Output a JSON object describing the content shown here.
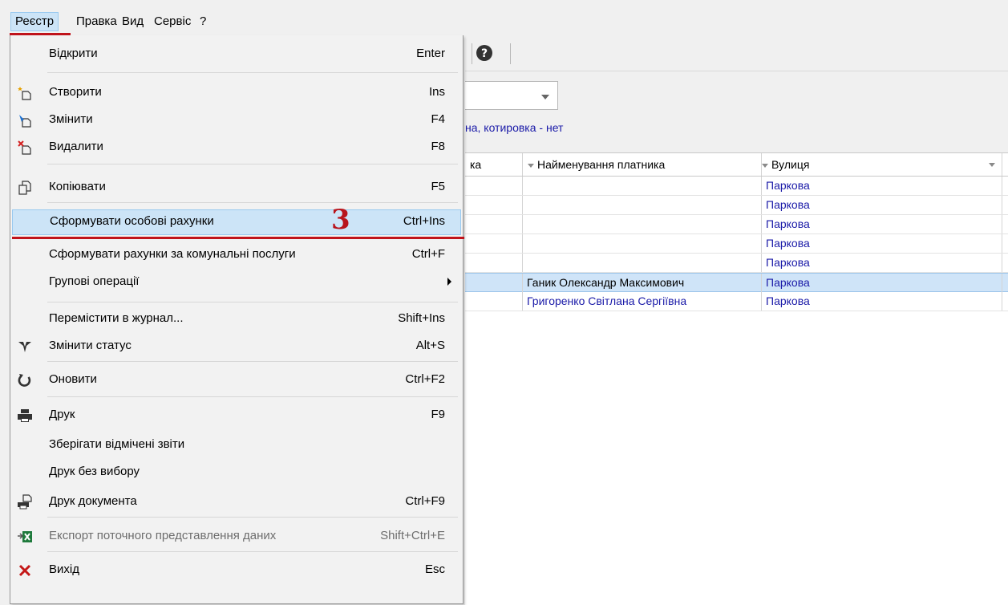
{
  "menubar": {
    "items": [
      "Реєстр",
      "Правка",
      "Вид",
      "Сервіс",
      "?"
    ]
  },
  "filter": {
    "info_text": "на, котировка - нет"
  },
  "grid": {
    "columns": [
      "ка",
      "Найменування платника",
      "Вулиця"
    ],
    "rows": [
      {
        "col1": "",
        "payer": "",
        "street": "Паркова"
      },
      {
        "col1": "",
        "payer": "",
        "street": "Паркова"
      },
      {
        "col1": "",
        "payer": "",
        "street": "Паркова"
      },
      {
        "col1": "",
        "payer": "",
        "street": "Паркова"
      },
      {
        "col1": "",
        "payer": "",
        "street": "Паркова"
      },
      {
        "col1": "",
        "payer": "Ганик Олександр Максимович",
        "street": "Паркова",
        "selected": true
      },
      {
        "col1": "",
        "payer": "Григоренко Світлана Сергіївна",
        "street": "Паркова"
      }
    ]
  },
  "menu": {
    "items": [
      {
        "label": "Відкрити",
        "shortcut": "Enter",
        "icon": "none"
      },
      {
        "label": "Створити",
        "shortcut": "Ins",
        "icon": "create-icon"
      },
      {
        "label": "Змінити",
        "shortcut": "F4",
        "icon": "edit-icon"
      },
      {
        "label": "Видалити",
        "shortcut": "F8",
        "icon": "delete-icon"
      },
      {
        "label": "Копіювати",
        "shortcut": "F5",
        "icon": "copy-icon"
      },
      {
        "label": "Сформувати особові рахунки",
        "shortcut": "Ctrl+Ins",
        "icon": "none",
        "highlighted": true
      },
      {
        "label": "Сформувати рахунки за комунальні послуги",
        "shortcut": "Ctrl+F",
        "icon": "none"
      },
      {
        "label": "Групові операції",
        "shortcut": "",
        "icon": "none",
        "submenu": true
      },
      {
        "label": "Перемістити в журнал...",
        "shortcut": "Shift+Ins",
        "icon": "none"
      },
      {
        "label": "Змінити статус",
        "shortcut": "Alt+S",
        "icon": "status-icon"
      },
      {
        "label": "Оновити",
        "shortcut": "Ctrl+F2",
        "icon": "refresh-icon"
      },
      {
        "label": "Друк",
        "shortcut": "F9",
        "icon": "printer-icon"
      },
      {
        "label": "Зберігати відмічені звіти",
        "shortcut": "",
        "icon": "none"
      },
      {
        "label": "Друк без вибору",
        "shortcut": "",
        "icon": "none"
      },
      {
        "label": "Друк документа",
        "shortcut": "Ctrl+F9",
        "icon": "print-document-icon"
      },
      {
        "label": "Експорт поточного представлення даних",
        "shortcut": "Shift+Ctrl+E",
        "icon": "excel-export-icon",
        "disabled": true
      },
      {
        "label": "Вихід",
        "shortcut": "Esc",
        "icon": "exit-icon"
      }
    ]
  },
  "annotation": {
    "step_number": "3"
  },
  "colors": {
    "accent_red": "#c0131b",
    "link_blue": "#1a1aa8",
    "highlight": "#cce4f7"
  }
}
